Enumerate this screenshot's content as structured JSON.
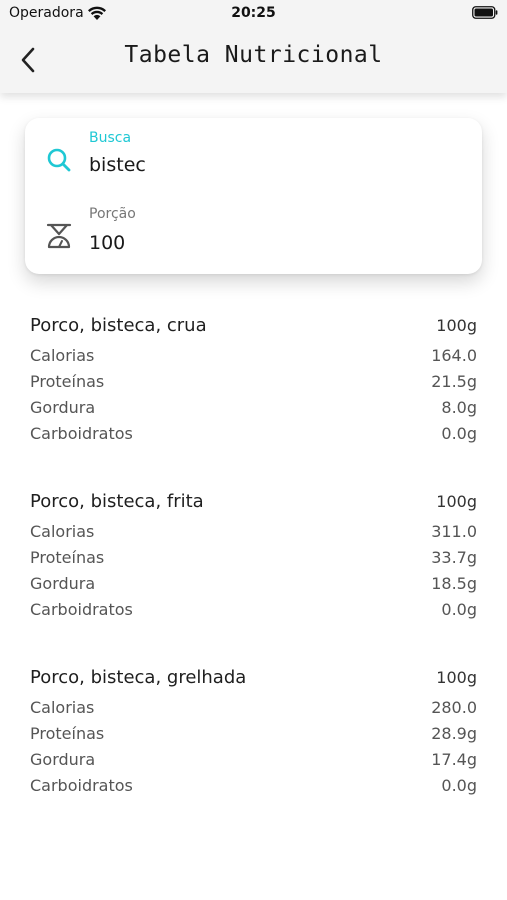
{
  "status_bar": {
    "carrier": "Operadora",
    "time": "20:25",
    "wifi_icon": "wifi-icon",
    "battery_icon": "battery-icon"
  },
  "header": {
    "title": "Tabela Nutricional",
    "back_icon": "chevron-left-icon"
  },
  "search_card": {
    "search": {
      "label": "Busca",
      "value": "bistec",
      "icon": "search-icon",
      "label_color": "#1fc8d4"
    },
    "portion": {
      "label": "Porção",
      "value": "100",
      "icon": "scale-icon",
      "label_color": "#777777"
    }
  },
  "results": [
    {
      "name": "Porco, bisteca, crua",
      "portion": "100g",
      "nutrients": [
        {
          "label": "Calorias",
          "value": "164.0"
        },
        {
          "label": "Proteínas",
          "value": "21.5g"
        },
        {
          "label": "Gordura",
          "value": "8.0g"
        },
        {
          "label": "Carboidratos",
          "value": "0.0g"
        }
      ]
    },
    {
      "name": "Porco, bisteca, frita",
      "portion": "100g",
      "nutrients": [
        {
          "label": "Calorias",
          "value": "311.0"
        },
        {
          "label": "Proteínas",
          "value": "33.7g"
        },
        {
          "label": "Gordura",
          "value": "18.5g"
        },
        {
          "label": "Carboidratos",
          "value": "0.0g"
        }
      ]
    },
    {
      "name": "Porco, bisteca, grelhada",
      "portion": "100g",
      "nutrients": [
        {
          "label": "Calorias",
          "value": "280.0"
        },
        {
          "label": "Proteínas",
          "value": "28.9g"
        },
        {
          "label": "Gordura",
          "value": "17.4g"
        },
        {
          "label": "Carboidratos",
          "value": "0.0g"
        }
      ]
    }
  ]
}
